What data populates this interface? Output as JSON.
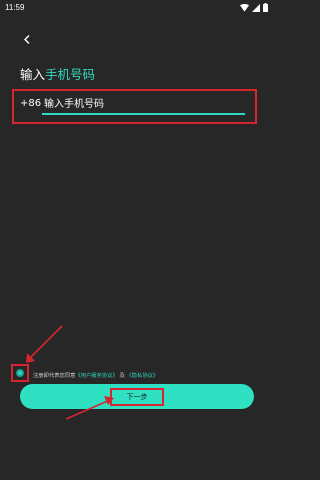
{
  "status_bar": {
    "time": "11:59",
    "icons": [
      "wifi-icon",
      "signal-icon",
      "battery-icon"
    ]
  },
  "header": {
    "back_icon": "chevron-left-icon",
    "title_prefix": "输入",
    "title_accent": "手机号码"
  },
  "phone": {
    "country_code": "+86",
    "placeholder": "输入手机号码"
  },
  "agreement": {
    "text_start": "注册即代表您同意",
    "user_agreement": "《用户服务协议》",
    "and": "及",
    "privacy_policy": "《隐私协议》"
  },
  "next_button": {
    "label": "下一步"
  },
  "colors": {
    "background": "#272727",
    "accent": "#2fd8c0",
    "highlight": "#d5262f"
  }
}
